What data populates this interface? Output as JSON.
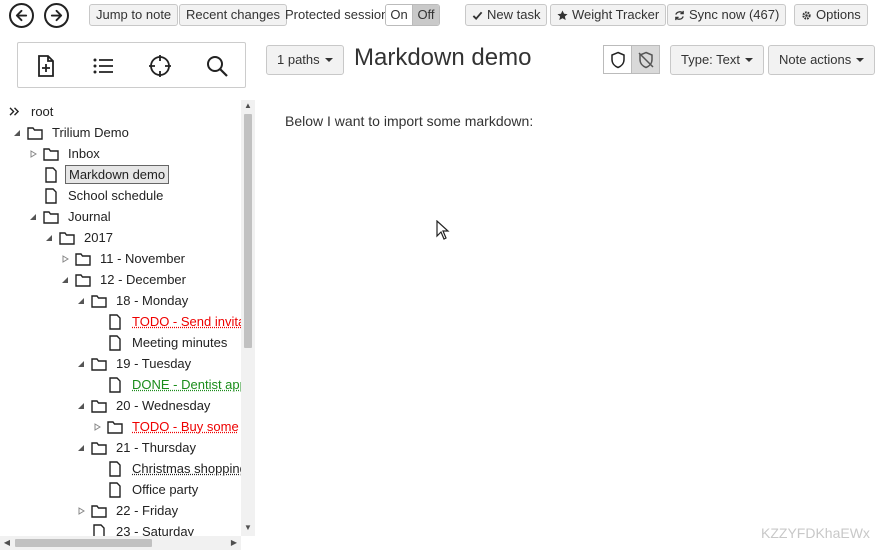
{
  "toolbar": {
    "back_icon": "back-arrow-icon",
    "forward_icon": "forward-arrow-icon",
    "jump_to_note": "Jump to note",
    "recent_changes": "Recent changes",
    "protected_session_label": "Protected session:",
    "protected_on": "On",
    "protected_off": "Off",
    "new_task": "New task",
    "weight_tracker": "Weight Tracker",
    "sync_now": "Sync now (467)",
    "options": "Options"
  },
  "tree": {
    "items": [
      {
        "label": "root"
      },
      {
        "label": "Trilium Demo"
      },
      {
        "label": "Inbox"
      },
      {
        "label": "Markdown demo"
      },
      {
        "label": "School schedule"
      },
      {
        "label": "Journal"
      },
      {
        "label": "2017"
      },
      {
        "label": "11 - November"
      },
      {
        "label": "12 - December"
      },
      {
        "label": "18 - Monday"
      },
      {
        "label": "TODO - Send invitation"
      },
      {
        "label": "Meeting minutes"
      },
      {
        "label": "19 - Tuesday"
      },
      {
        "label": "DONE - Dentist appointment"
      },
      {
        "label": "20 - Wednesday"
      },
      {
        "label": "TODO - Buy some"
      },
      {
        "label": "21 - Thursday"
      },
      {
        "label": "Christmas shopping"
      },
      {
        "label": "Office party"
      },
      {
        "label": "22 - Friday"
      },
      {
        "label": "23 - Saturday"
      }
    ]
  },
  "note": {
    "paths": "1 paths",
    "title": "Markdown demo",
    "type": "Type: Text",
    "actions": "Note actions",
    "content": "Below I want to import some markdown:"
  },
  "watermark": "KZZYFDKhaEWx"
}
